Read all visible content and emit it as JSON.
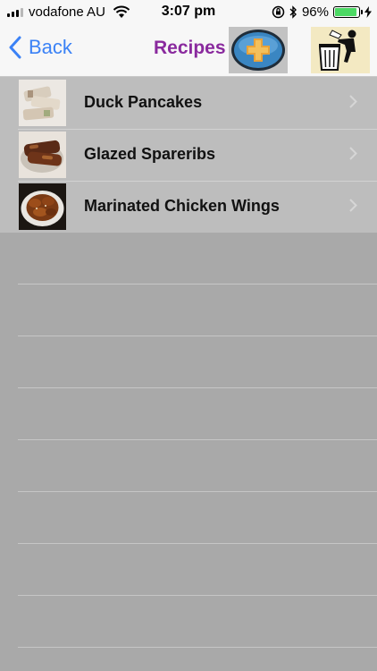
{
  "status_bar": {
    "carrier": "vodafone AU",
    "time": "3:07 pm",
    "battery_percent": "96%",
    "battery_level": 0.96
  },
  "nav": {
    "back_label": "Back",
    "title": "Recipes",
    "add_icon": "add-circle-icon",
    "trash_icon": "trash-bin-icon"
  },
  "recipes": [
    {
      "name": "Duck Pancakes"
    },
    {
      "name": "Glazed Spareribs"
    },
    {
      "name": "Marinated Chicken Wings"
    }
  ],
  "colors": {
    "accent": "#3b82f6",
    "title": "#8a2a9e",
    "battery": "#4cd964"
  }
}
